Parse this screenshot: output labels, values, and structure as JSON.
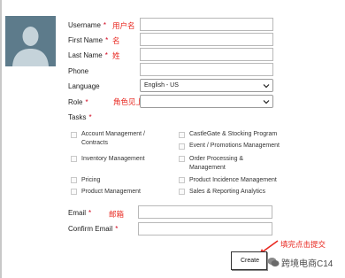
{
  "form": {
    "username_label": "Username",
    "first_name_label": "First Name",
    "last_name_label": "Last Name",
    "phone_label": "Phone",
    "language_label": "Language",
    "language_value": "English - US",
    "role_label": "Role",
    "tasks_label": "Tasks",
    "email_label": "Email",
    "confirm_email_label": "Confirm Email",
    "required_mark": "*",
    "create_label": "Create"
  },
  "annotations": {
    "username": "用户名",
    "first_name": "名",
    "last_name": "姓",
    "role": "角色见上文截图，按需选择",
    "email": "邮箱",
    "submit": "填完点击提交"
  },
  "tasks": {
    "left": [
      {
        "label": "Account Management /\nContracts"
      },
      {
        "label": "Inventory Management"
      },
      {
        "label": "Pricing"
      },
      {
        "label": "Product Management"
      }
    ],
    "right": [
      {
        "label": "CastleGate & Stocking Program"
      },
      {
        "label": "Event / Promotions Management"
      },
      {
        "label": "Order Processing &\nManagement"
      },
      {
        "label": "Product Incidence Management"
      },
      {
        "label": "Sales & Reporting Analytics"
      }
    ]
  },
  "watermark": {
    "text": "跨境电商C14"
  },
  "colors": {
    "accent_red": "#e8271f",
    "required_red": "#d0021b",
    "avatar_bg": "#5d7b8b"
  }
}
